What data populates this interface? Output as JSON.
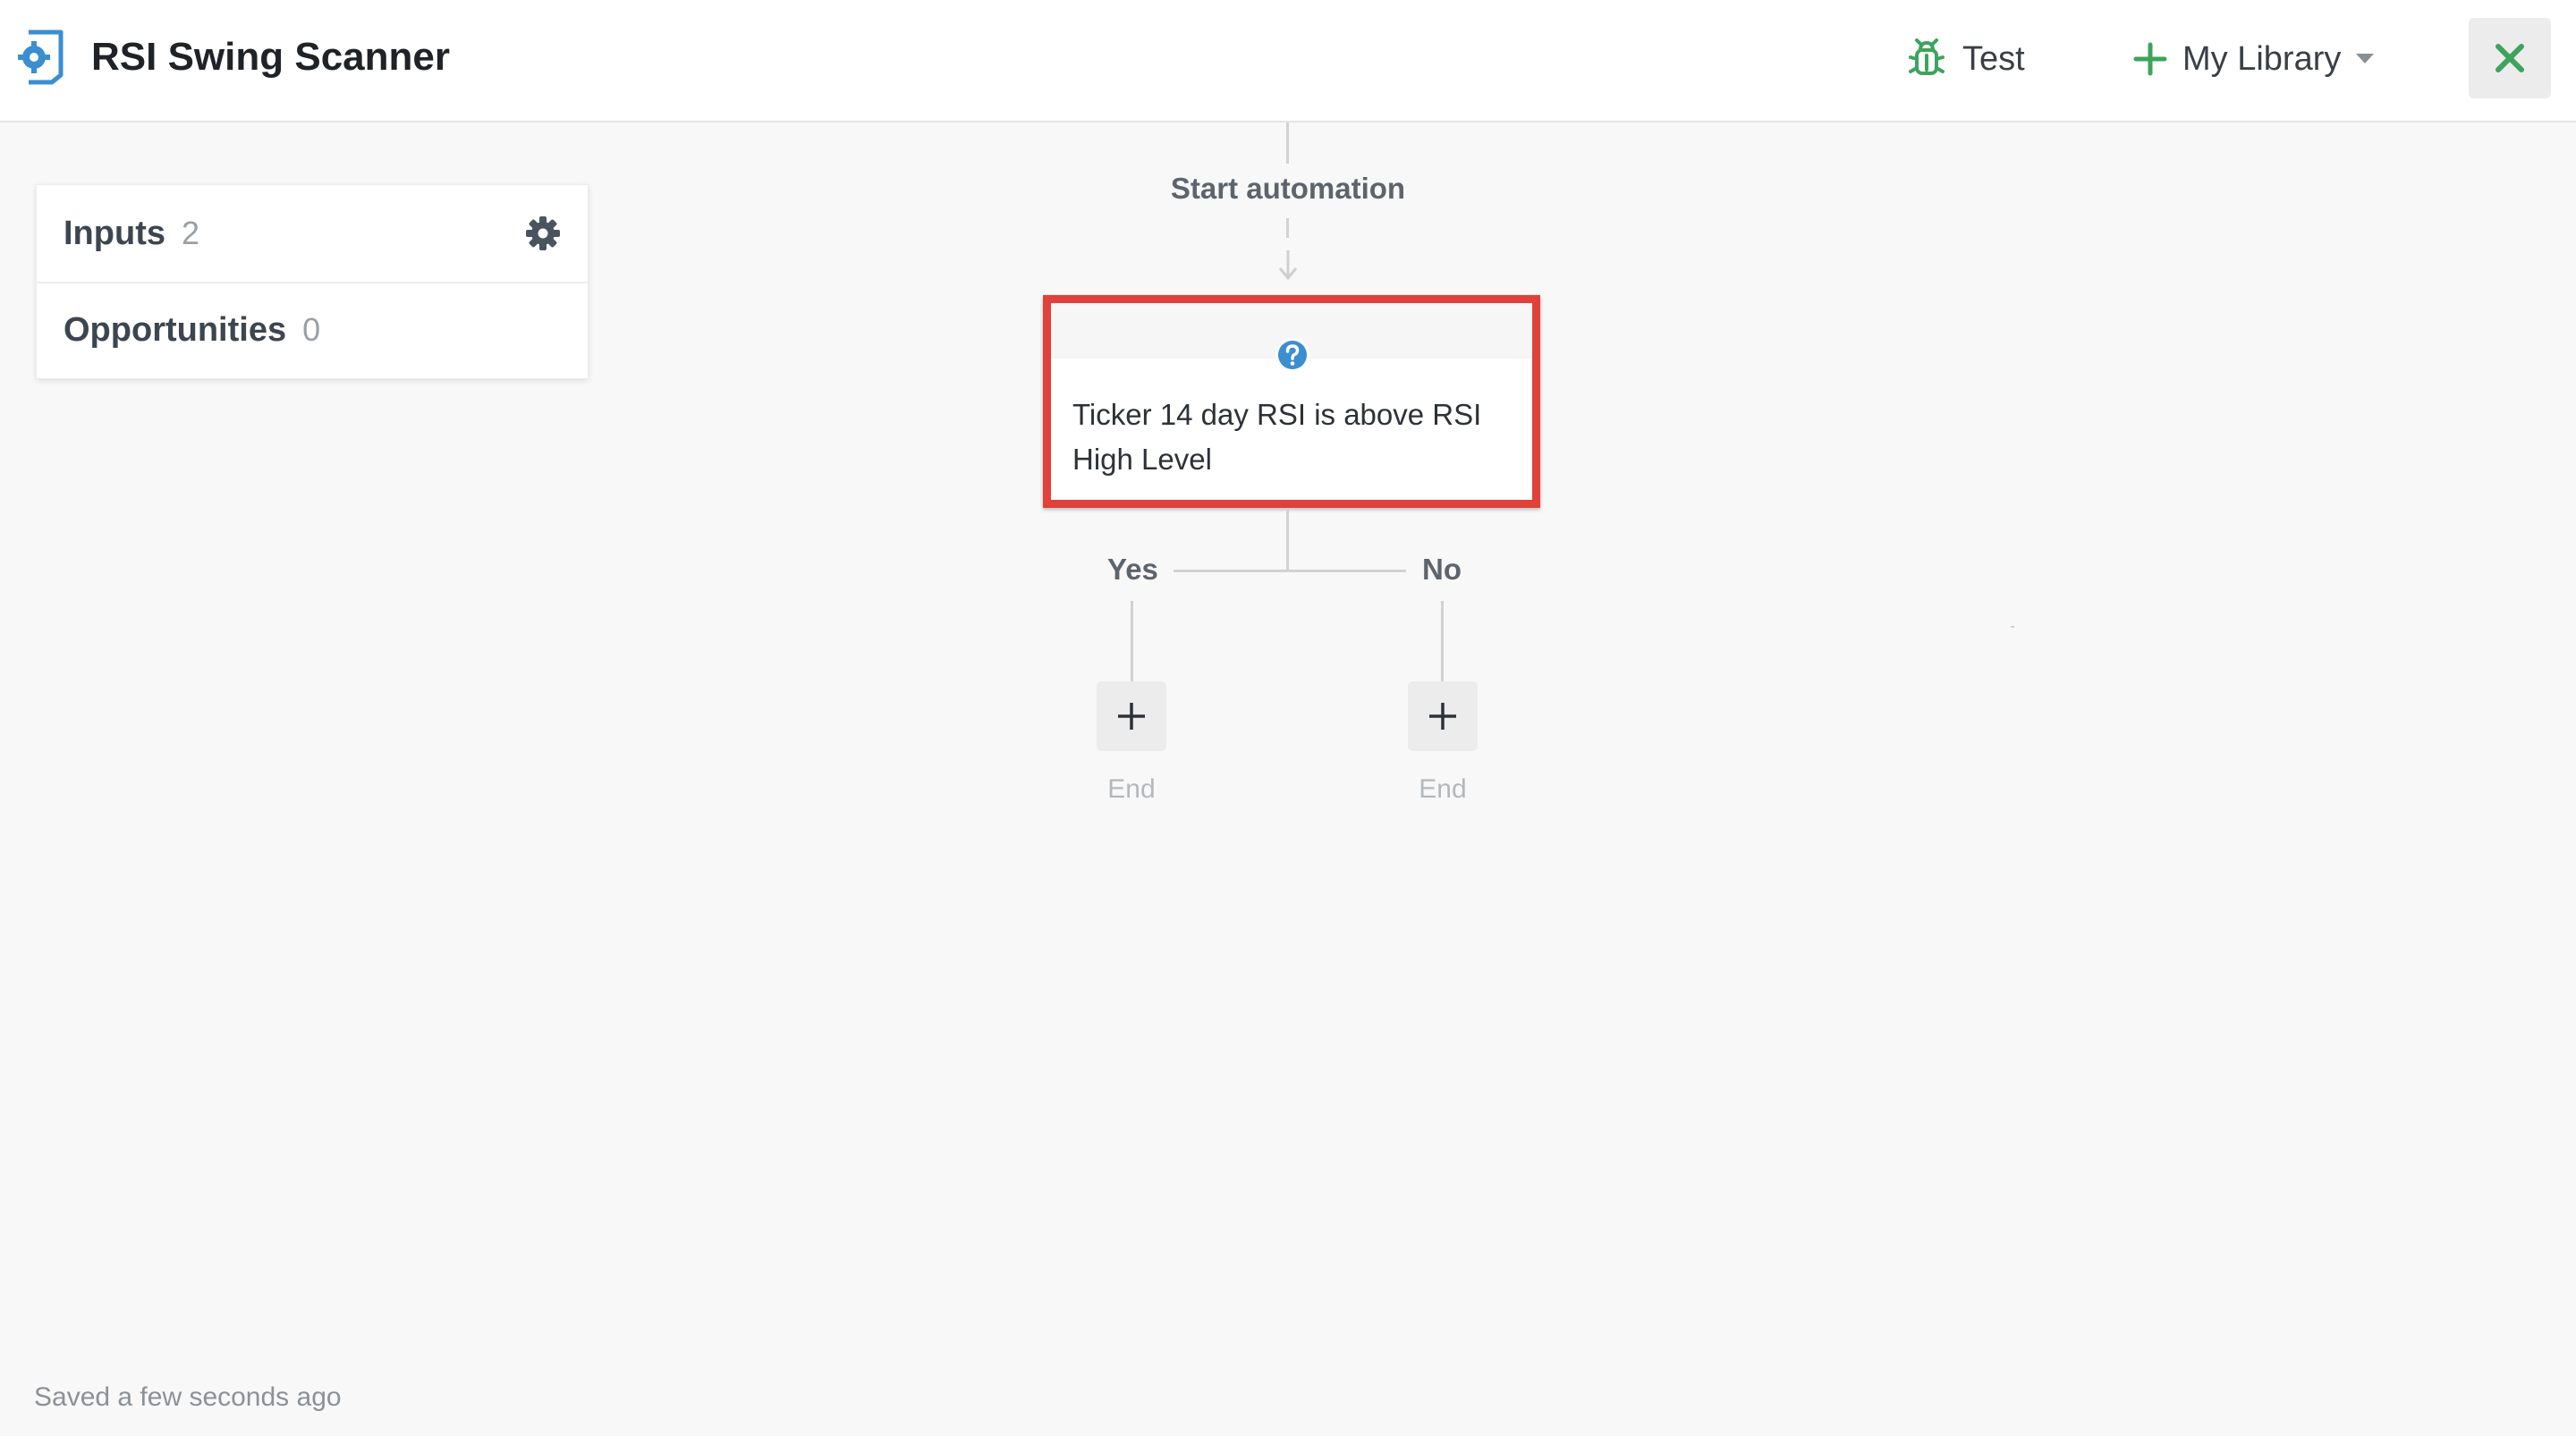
{
  "header": {
    "title": "RSI Swing Scanner",
    "test_label": "Test",
    "library_label": "My Library",
    "accent_color": "#3da35d",
    "app_icon_color": "#3b8ed0"
  },
  "panel": {
    "items": [
      {
        "label": "Inputs",
        "count": "2"
      },
      {
        "label": "Opportunities",
        "count": "0"
      }
    ]
  },
  "flow": {
    "start_label": "Start automation",
    "condition_text": "Ticker 14 day RSI is above RSI High Level",
    "condition_highlight_color": "#e0413b",
    "branches": [
      {
        "label": "Yes",
        "end_label": "End"
      },
      {
        "label": "No",
        "end_label": "End"
      }
    ]
  },
  "footer": {
    "saved_status": "Saved a few seconds ago"
  }
}
